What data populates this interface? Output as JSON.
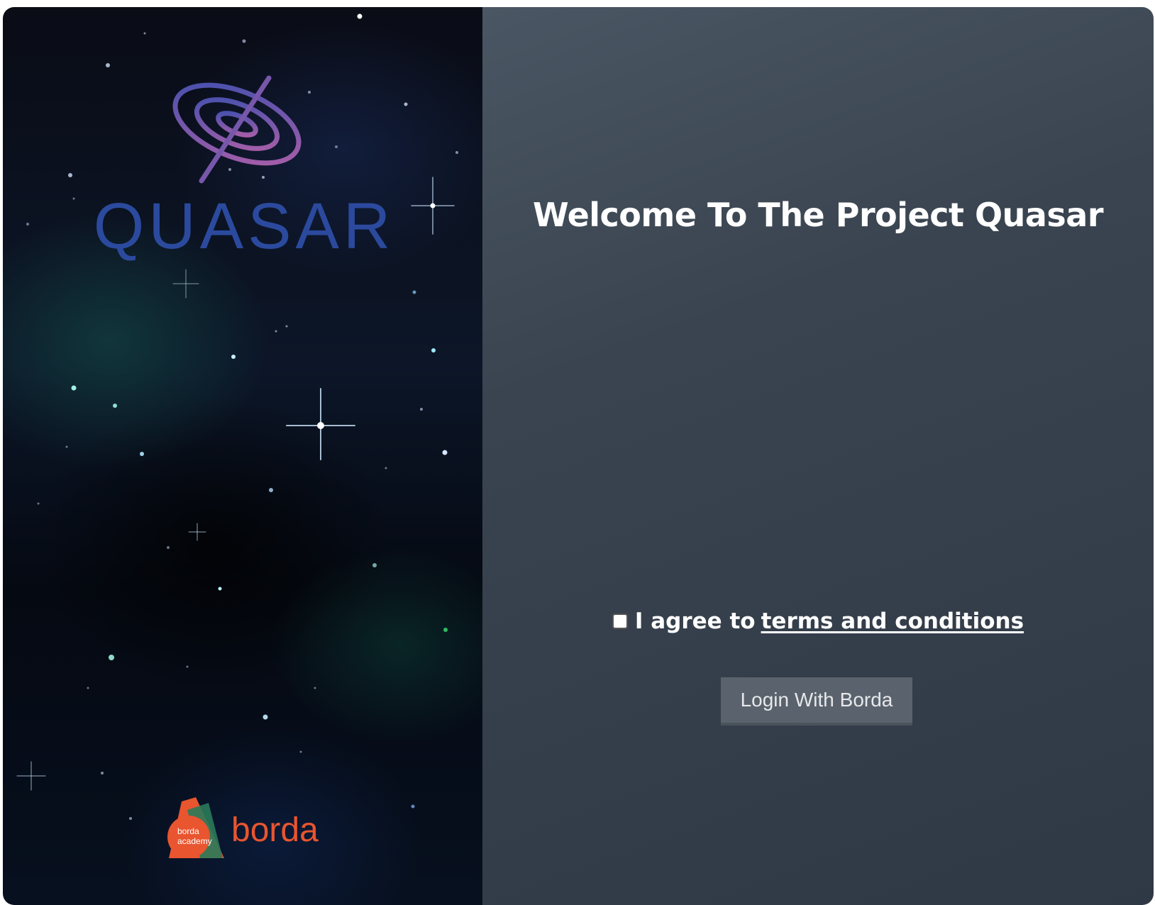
{
  "brand": {
    "logo_text": "QUASAR",
    "partner_logo_text": "borda",
    "partner_badge_text": "borda academy"
  },
  "main": {
    "title": "Welcome To The Project Quasar",
    "agree_prefix": "I agree to",
    "terms_link": "terms and conditions",
    "terms_checked": false,
    "login_button": "Login With Borda"
  },
  "colors": {
    "logo_blue": "#2b4a9e",
    "logo_gradient_start": "#3d4fae",
    "logo_gradient_end": "#b15fa8",
    "borda_orange": "#e8552f",
    "panel_dark": "#343e4a",
    "button_gray": "#5a636d"
  },
  "icons": {
    "checkbox": "checkbox-unchecked-icon",
    "logo": "quasar-spiral-logo",
    "partner": "borda-academy-logo"
  }
}
